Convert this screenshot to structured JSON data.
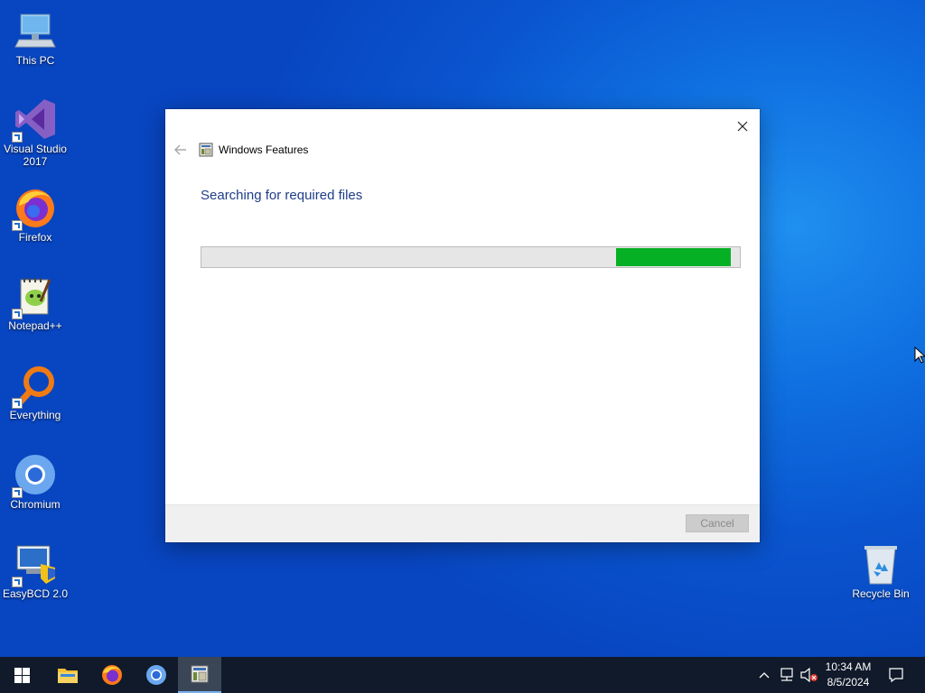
{
  "desktop": {
    "icons": [
      {
        "label": "This PC"
      },
      {
        "label": "Visual Studio 2017"
      },
      {
        "label": "Firefox"
      },
      {
        "label": "Notepad++"
      },
      {
        "label": "Everything"
      },
      {
        "label": "Chromium"
      },
      {
        "label": "EasyBCD 2.0"
      },
      {
        "label": "Recycle Bin"
      }
    ]
  },
  "dialog": {
    "title": "Windows Features",
    "heading": "Searching for required files",
    "progress": {
      "fill_start": 0.77,
      "fill_end": 0.983
    },
    "cancel_label": "Cancel",
    "accent_color": "#06b025"
  },
  "taskbar": {
    "apps": [
      "start-icon",
      "file-explorer-icon",
      "firefox-icon",
      "chromium-icon",
      "windows-features-icon"
    ],
    "clock": {
      "time": "10:34 AM",
      "date": "8/5/2024"
    },
    "tray": [
      "chevron-up-icon",
      "network-icon",
      "volume-muted-icon",
      "notification-icon"
    ]
  }
}
